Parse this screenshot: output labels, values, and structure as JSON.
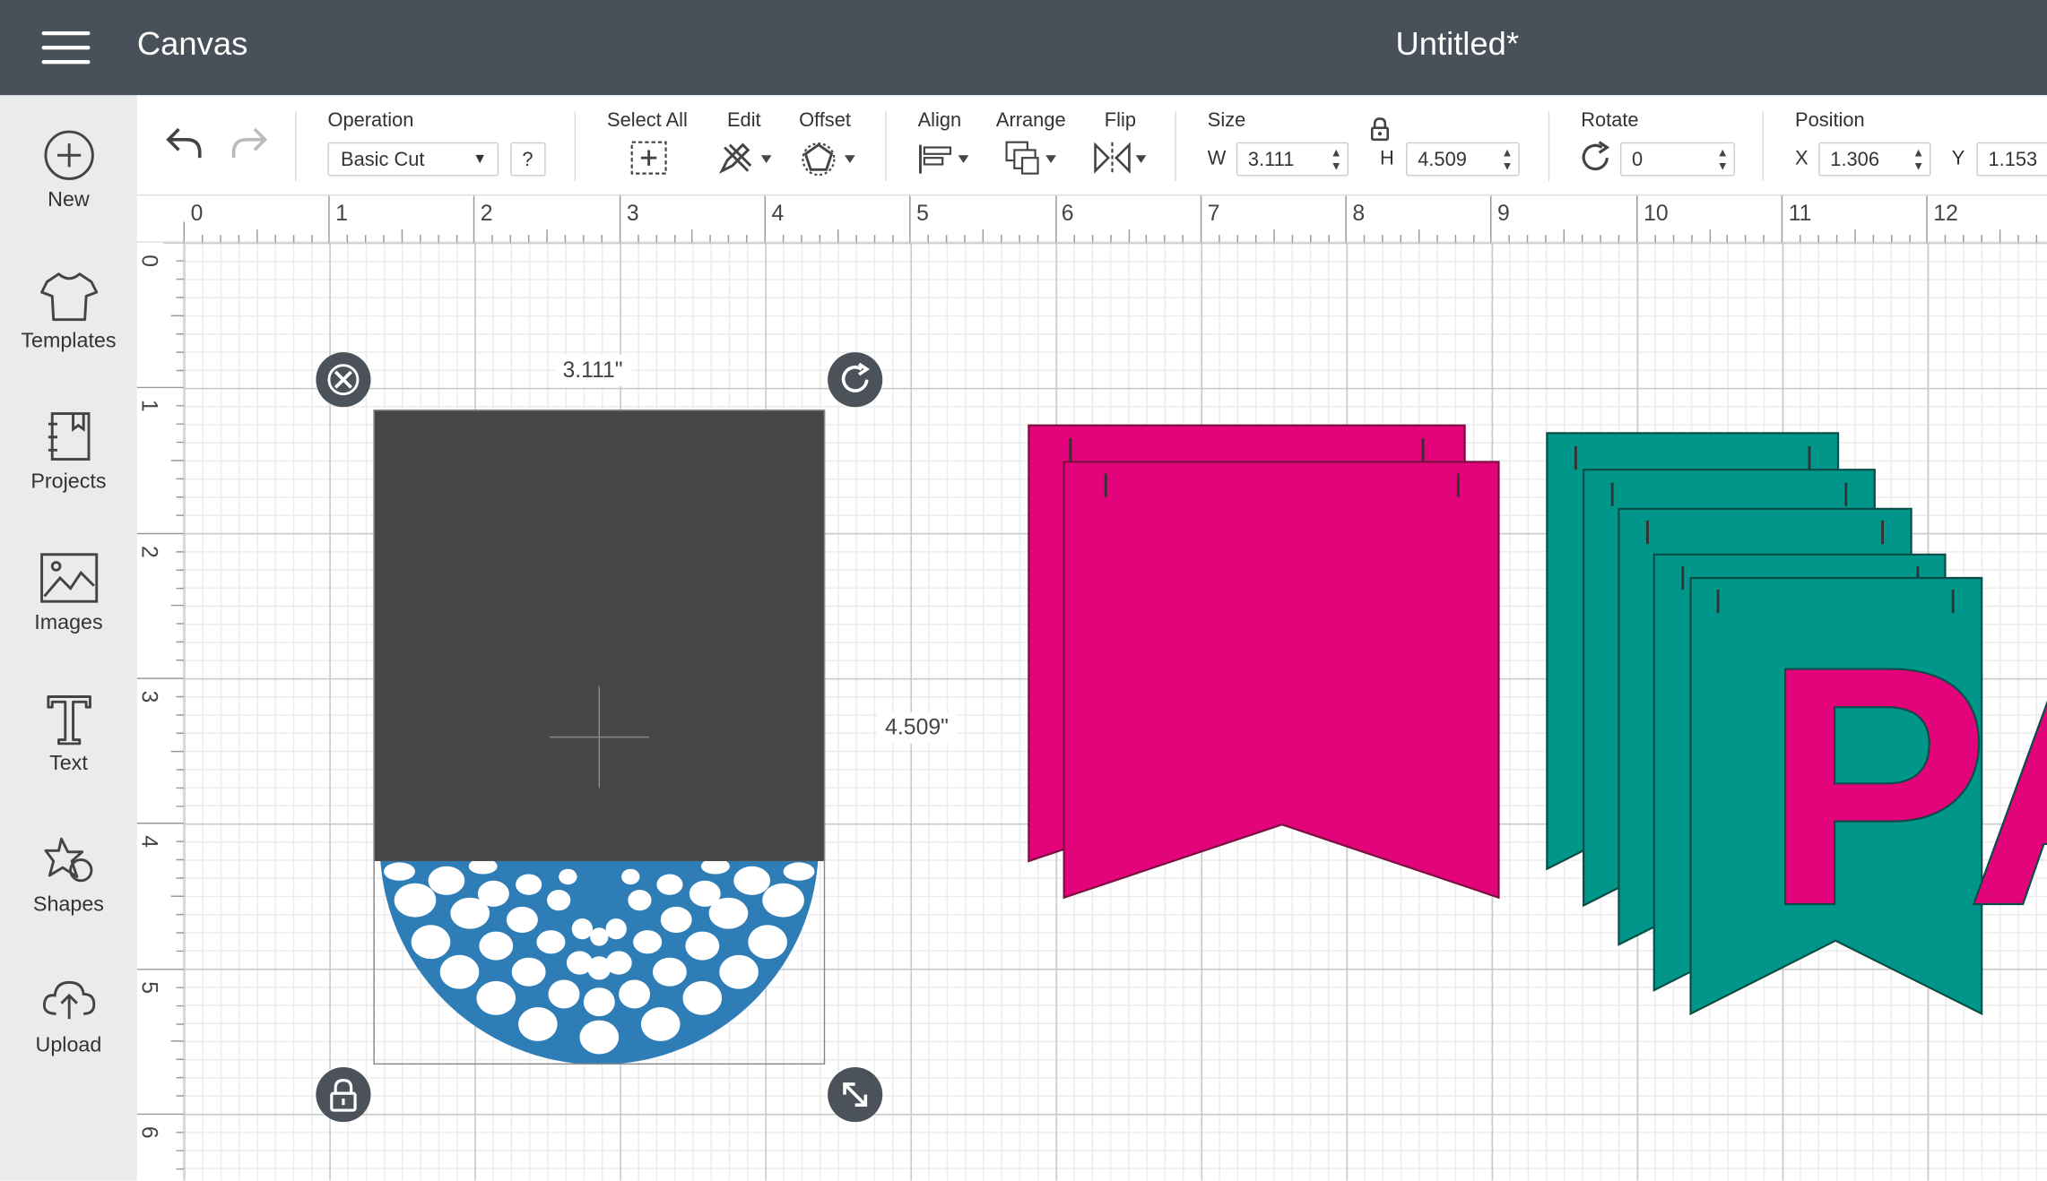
{
  "header": {
    "app_title": "Canvas",
    "doc_title": "Untitled*"
  },
  "sidebar": {
    "items": [
      {
        "label": "New",
        "icon": "plus-circle-icon"
      },
      {
        "label": "Templates",
        "icon": "tshirt-icon"
      },
      {
        "label": "Projects",
        "icon": "notebook-icon"
      },
      {
        "label": "Images",
        "icon": "image-icon"
      },
      {
        "label": "Text",
        "icon": "text-t-icon"
      },
      {
        "label": "Shapes",
        "icon": "shapes-icon"
      },
      {
        "label": "Upload",
        "icon": "cloud-upload-icon"
      }
    ]
  },
  "toolbar": {
    "operation_label": "Operation",
    "operation_value": "Basic Cut",
    "help_label": "?",
    "select_all_label": "Select All",
    "edit_label": "Edit",
    "offset_label": "Offset",
    "align_label": "Align",
    "arrange_label": "Arrange",
    "flip_label": "Flip",
    "size_label": "Size",
    "width_prefix": "W",
    "width_value": "3.111",
    "height_prefix": "H",
    "height_value": "4.509",
    "rotate_label": "Rotate",
    "rotate_value": "0",
    "position_label": "Position",
    "x_prefix": "X",
    "x_value": "1.306",
    "y_prefix": "Y",
    "y_value": "1.153"
  },
  "rulers": {
    "top": [
      "0",
      "1",
      "2",
      "3",
      "4",
      "5",
      "6",
      "7",
      "8",
      "9",
      "10",
      "11",
      "12"
    ],
    "left": [
      "0",
      "1",
      "2",
      "3",
      "4",
      "5",
      "6"
    ]
  },
  "selection": {
    "width_label": "3.111\"",
    "height_label": "4.509\""
  },
  "banner_text": "PA",
  "colors": {
    "header_bg": "#485059",
    "sidebar_bg": "#eaebec",
    "pink": "#e3037a",
    "teal": "#00968a",
    "blue": "#2f7db6",
    "dark_rect": "#464646"
  }
}
